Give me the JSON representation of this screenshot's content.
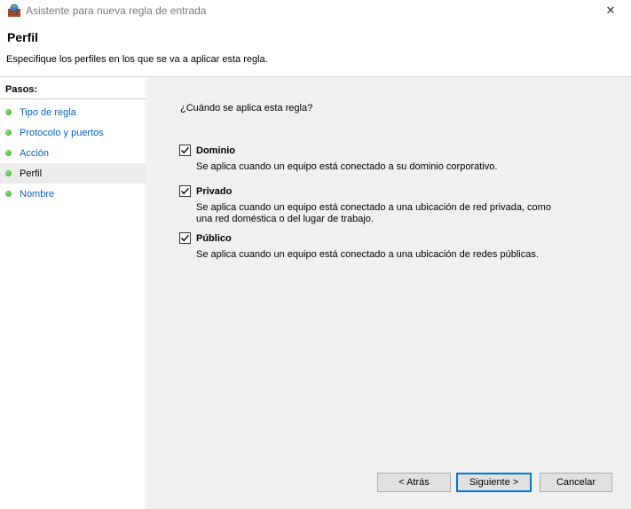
{
  "window": {
    "title": "Asistente para nueva regla de entrada",
    "close_glyph": "✕"
  },
  "header": {
    "title": "Perfil",
    "description": "Especifique los perfiles en los que se va a aplicar esta regla."
  },
  "sidebar": {
    "title": "Pasos:",
    "items": [
      {
        "label": "Tipo de regla"
      },
      {
        "label": "Protocolo y puertos"
      },
      {
        "label": "Acción"
      },
      {
        "label": "Perfil",
        "active": true
      },
      {
        "label": "Nombre"
      }
    ]
  },
  "main": {
    "question": "¿Cuándo se aplica esta regla?",
    "options": [
      {
        "label": "Dominio",
        "checked": true,
        "description": "Se aplica cuando un equipo está conectado a su dominio corporativo."
      },
      {
        "label": "Privado",
        "checked": true,
        "description": "Se aplica cuando un equipo está conectado a una ubicación de red privada, como una red doméstica o del lugar de trabajo."
      },
      {
        "label": "Público",
        "checked": true,
        "description": "Se aplica cuando un equipo está conectado a una ubicación de redes públicas."
      }
    ]
  },
  "buttons": {
    "back": "< Atrás",
    "next": "Siguiente >",
    "cancel": "Cancelar"
  },
  "colors": {
    "step_link": "#0563c1",
    "step_dot": "#3aa629",
    "content_bg": "#f0f0f0",
    "primary_border": "#0078d7"
  },
  "icons": {
    "app": "firewall-icon",
    "close": "close-icon",
    "step": "green-dot-icon",
    "check": "checkmark-icon"
  }
}
